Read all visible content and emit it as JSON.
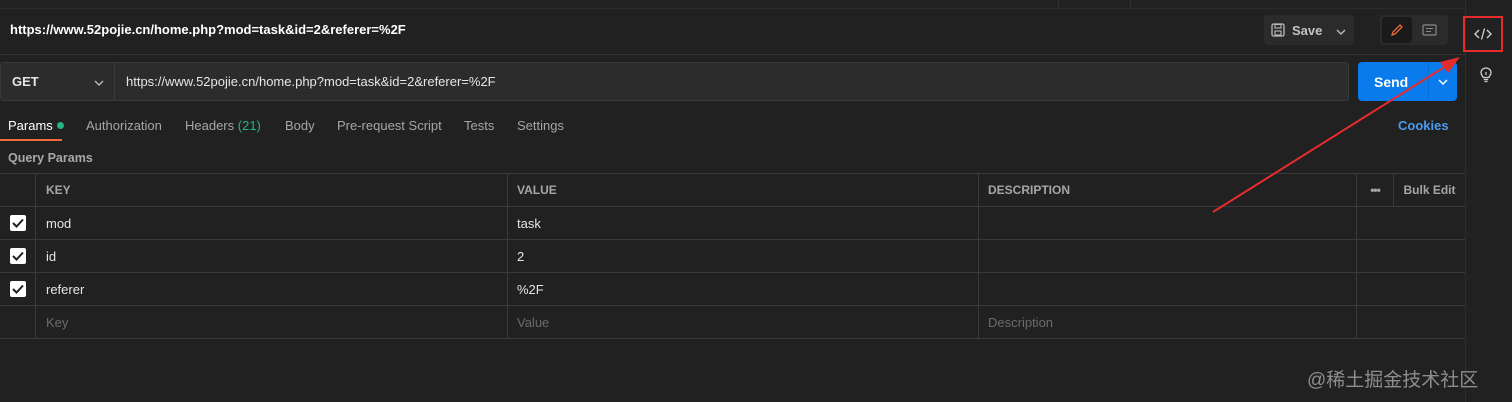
{
  "request_title": "https://www.52pojie.cn/home.php?mod=task&id=2&referer=%2F",
  "toolbar": {
    "save_label": "Save",
    "icons": [
      "save-icon",
      "chevron-down-icon",
      "pencil-icon",
      "comment-icon",
      "code-icon",
      "lightbulb-icon"
    ]
  },
  "request": {
    "method": "GET",
    "url": "https://www.52pojie.cn/home.php?mod=task&id=2&referer=%2F",
    "send_label": "Send"
  },
  "tabs": {
    "params": "Params",
    "authorization": "Authorization",
    "headers": "Headers",
    "headers_count": "(21)",
    "body": "Body",
    "prerequest": "Pre-request Script",
    "tests": "Tests",
    "settings": "Settings",
    "cookies": "Cookies"
  },
  "query_params": {
    "title": "Query Params",
    "columns": {
      "key": "KEY",
      "value": "VALUE",
      "description": "DESCRIPTION",
      "more": "•••",
      "bulk_edit": "Bulk Edit"
    },
    "rows": [
      {
        "checked": true,
        "key": "mod",
        "value": "task",
        "description": ""
      },
      {
        "checked": true,
        "key": "id",
        "value": "2",
        "description": ""
      },
      {
        "checked": true,
        "key": "referer",
        "value": "%2F",
        "description": ""
      }
    ],
    "placeholders": {
      "key": "Key",
      "value": "Value",
      "description": "Description"
    }
  },
  "watermark": "@稀土掘金技术社区",
  "colors": {
    "background": "#212121",
    "send": "#097bed",
    "active_tab_underline": "#f26b3a",
    "status_dot": "#26b47f",
    "cookies_link": "#4a9aef",
    "annotation": "#e52b2b"
  }
}
